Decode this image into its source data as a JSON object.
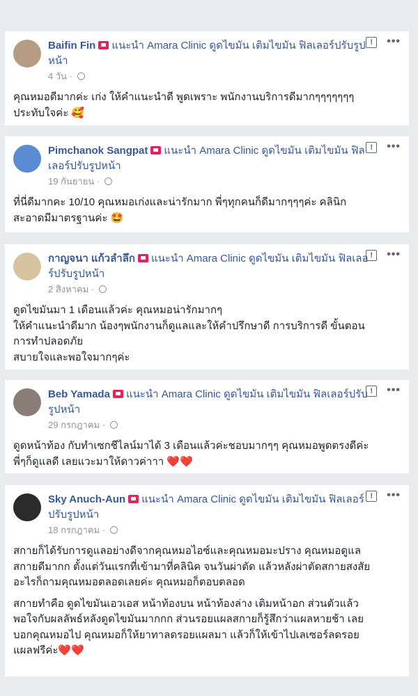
{
  "reviews": [
    {
      "name": "Baifin Fin",
      "recommend": "แนะนำ Amara Clinic ดูดไขมัน เติมไขมัน ฟิลเลอร์ปรับรูปหน้า",
      "time": "4 วัน",
      "lines": [
        "คุณหมอดีมากค่ะ เก่ง ให้คำแนะนำดี พูดเพราะ พนักงานบริการดีมากๆๆๆๆๆๆๆ",
        "ประทับใจค่ะ 🥰"
      ],
      "avatar_color": "#b59c82"
    },
    {
      "name": "Pimchanok Sangpat",
      "recommend": "แนะนำ Amara Clinic ดูดไขมัน เติมไขมัน ฟิลเลอร์ปรับรูปหน้า",
      "time": "19 กันยายน",
      "lines": [
        "ที่นี่ดีมากคะ 10/10 คุณหมอเก่งและน่ารักมาก พี่ๆทุกคนก็ดีมากๆๆๆค่ะ คลินิก",
        "สะอาดมีมาตรฐานค่ะ 🤩"
      ],
      "avatar_color": "#5b8bd0"
    },
    {
      "name": "กาญจนา แก้วลำลึก",
      "recommend": "แนะนำ Amara Clinic ดูดไขมัน เติมไขมัน ฟิลเลอร์ปรับรูปหน้า",
      "time": "2 สิงหาคม",
      "lines": [
        "ดูดไขมันมา 1 เดือนแล้วค่ะ คุณหมอน่ารักมากๆ",
        "ให้คำแนะนำดีมาก น้องๆพนักงานก็ดูแลและให้คำปรึกษาดี การบริการดี ขั้นตอน",
        "การทำปลอดภัย",
        "สบายใจและพอใจมากๆค่ะ"
      ],
      "avatar_color": "#d8c3a0"
    },
    {
      "name": "Beb Yamada",
      "recommend": "แนะนำ Amara Clinic ดูดไขมัน เติมไขมัน ฟิลเลอร์ปรับรูปหน้า",
      "time": "29 กรกฎาคม",
      "lines": [
        "ดูดหน้าท้อง กับทำเซกชีไลน์มาได้ 3 เดือนแล้วค่ะชอบมากๆๆ คุณหมอพูดตรงดีค่ะ",
        "พี่ๆก็ดูแลดี เลยแวะมาให้ดาวค่าาา ❤️❤️"
      ],
      "avatar_color": "#8a7d77"
    },
    {
      "name": "Sky Anuch-Aun",
      "recommend": "แนะนำ Amara Clinic ดูดไขมัน เติมไขมัน ฟิลเลอร์ปรับรูปหน้า",
      "time": "18 กรกฎาคม",
      "lines": [
        "สกายก็ได้รับการดูแลอย่างดีจากคุณหมอไอซ์และคุณหมอมะปราง คุณหมอดูแล",
        "สกายดีมากก ตั้งแต่วันแรกที่เข้ามาที่คลินิค จนวันผ่าตัด แล้วหลังผ่าตัดสกายสงสัย",
        "อะไรก็ถามคุณหมอตลอดเลยค่ะ คุณหมอก็ตอบตลอด"
      ],
      "lines2": [
        "สกายทำคือ ดูดไขมันเอวเอส หน้าท้องบน หน้าท้องล่าง เติมหน้าอก ส่วนตัวแล้ว",
        "พอใจกับผลลัพธ์หลังดูดไขมันมากกก ส่วนรอยแผลสกายก็รู้สึกว่าแผลหายช้า เลย",
        "บอกคุณหมอไป คุณหมอก็ให้ยาทาลดรอยแผลมา แล้วก็ให้เข้าไปเลเซอร์ลดรอย",
        "แผลฟรีค่ะ❤️❤️"
      ],
      "avatar_color": "#2b2b2b"
    }
  ],
  "icons": {
    "report": "report-icon",
    "more": "more-icon",
    "globe": "globe-icon",
    "flag": "recommend-flag-icon"
  },
  "more_label": "•••",
  "report_label": "!"
}
